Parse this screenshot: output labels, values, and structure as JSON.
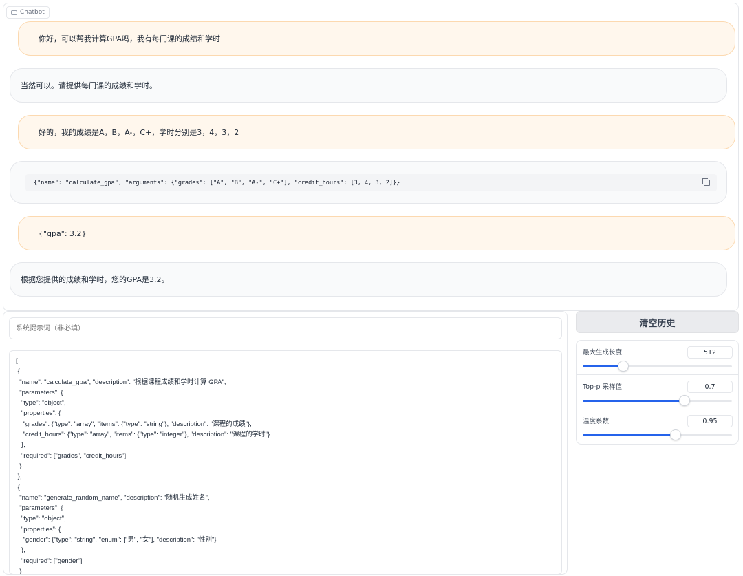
{
  "chatbot": {
    "label": "Chatbot",
    "messages": [
      {
        "role": "user",
        "text": "你好，可以帮我计算GPA吗，我有每门课的成绩和学时"
      },
      {
        "role": "bot",
        "text": "当然可以。请提供每门课的成绩和学时。"
      },
      {
        "role": "user",
        "text": "好的，我的成绩是A，B，A-，C+，学时分别是3，4，3，2"
      },
      {
        "role": "bot",
        "code": "{\"name\": \"calculate_gpa\", \"arguments\": {\"grades\": [\"A\", \"B\", \"A-\", \"C+\"], \"credit_hours\": [3, 4, 3, 2]}}"
      },
      {
        "role": "user",
        "text": "{\"gpa\": 3.2}"
      },
      {
        "role": "bot",
        "text": "根据您提供的成绩和学时，您的GPA是3.2。"
      }
    ]
  },
  "system_prompt": {
    "placeholder": "系统提示词（非必填）"
  },
  "tools_text": "[\n {\n  \"name\": \"calculate_gpa\", \"description\": \"根据课程成绩和学时计算 GPA\",\n  \"parameters\": {\n   \"type\": \"object\",\n   \"properties\": {\n    \"grades\": {\"type\": \"array\", \"items\": {\"type\": \"string\"}, \"description\": \"课程的成绩\"},\n    \"credit_hours\": {\"type\": \"array\", \"items\": {\"type\": \"integer\"}, \"description\": \"课程的学时\"}\n   },\n   \"required\": [\"grades\", \"credit_hours\"]\n  }\n },\n {\n  \"name\": \"generate_random_name\", \"description\": \"随机生成姓名\",\n  \"parameters\": {\n   \"type\": \"object\",\n   \"properties\": {\n    \"gender\": {\"type\": \"string\", \"enum\": [\"男\", \"女\"], \"description\": \"性别\"}\n   },\n   \"required\": [\"gender\"]\n  }\n }\n]",
  "clear_button": "清空历史",
  "settings": {
    "max_length": {
      "label": "最大生成长度",
      "value": "512",
      "fraction": 0.27
    },
    "top_p": {
      "label": "Top-p 采样值",
      "value": "0.7",
      "fraction": 0.68
    },
    "temperature": {
      "label": "温度系数",
      "value": "0.95",
      "fraction": 0.62
    }
  },
  "colors": {
    "accent": "#2563eb",
    "user_bubble": "#fff7ed",
    "bot_bubble": "#f9fafb"
  }
}
